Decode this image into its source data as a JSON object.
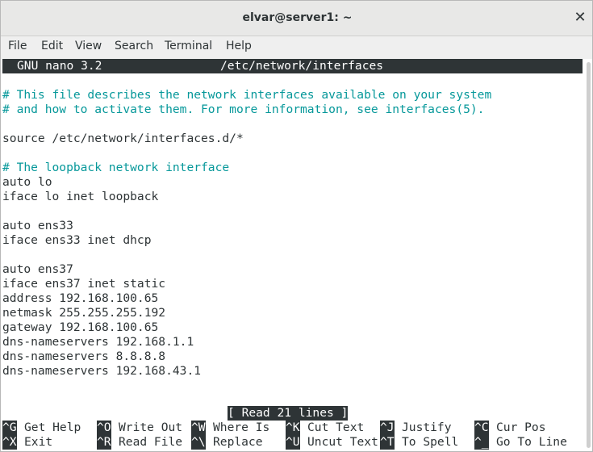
{
  "window": {
    "title": "elvar@server1: ~",
    "close_glyph": "✕"
  },
  "menu": [
    "File",
    "Edit",
    "View",
    "Search",
    "Terminal",
    "Help"
  ],
  "nano": {
    "version": "GNU nano 3.2",
    "filename": "/etc/network/interfaces",
    "status_message": "[ Read 21 lines ]"
  },
  "file_lines": [
    "",
    "# This file describes the network interfaces available on your system",
    "# and how to activate them. For more information, see interfaces(5).",
    "",
    "source /etc/network/interfaces.d/*",
    "",
    "# The loopback network interface",
    "auto lo",
    "iface lo inet loopback",
    "",
    "auto ens33",
    "iface ens33 inet dhcp",
    "",
    "auto ens37",
    "iface ens37 inet static",
    "address 192.168.100.65",
    "netmask 255.255.255.192",
    "gateway 192.168.100.65",
    "dns-nameservers 192.168.1.1",
    "dns-nameservers 8.8.8.8",
    "dns-nameservers 192.168.43.1"
  ],
  "shortcuts": [
    [
      {
        "key": "^G",
        "label": "Get Help"
      },
      {
        "key": "^O",
        "label": "Write Out"
      },
      {
        "key": "^W",
        "label": "Where Is"
      },
      {
        "key": "^K",
        "label": "Cut Text"
      },
      {
        "key": "^J",
        "label": "Justify"
      },
      {
        "key": "^C",
        "label": "Cur Pos"
      }
    ],
    [
      {
        "key": "^X",
        "label": "Exit"
      },
      {
        "key": "^R",
        "label": "Read File"
      },
      {
        "key": "^\\",
        "label": "Replace"
      },
      {
        "key": "^U",
        "label": "Uncut Text"
      },
      {
        "key": "^T",
        "label": "To Spell"
      },
      {
        "key": "^_",
        "label": "Go To Line"
      }
    ]
  ],
  "colors": {
    "comment": "#06989a",
    "text": "#2e3436",
    "inverse_bg": "#2e3436"
  }
}
